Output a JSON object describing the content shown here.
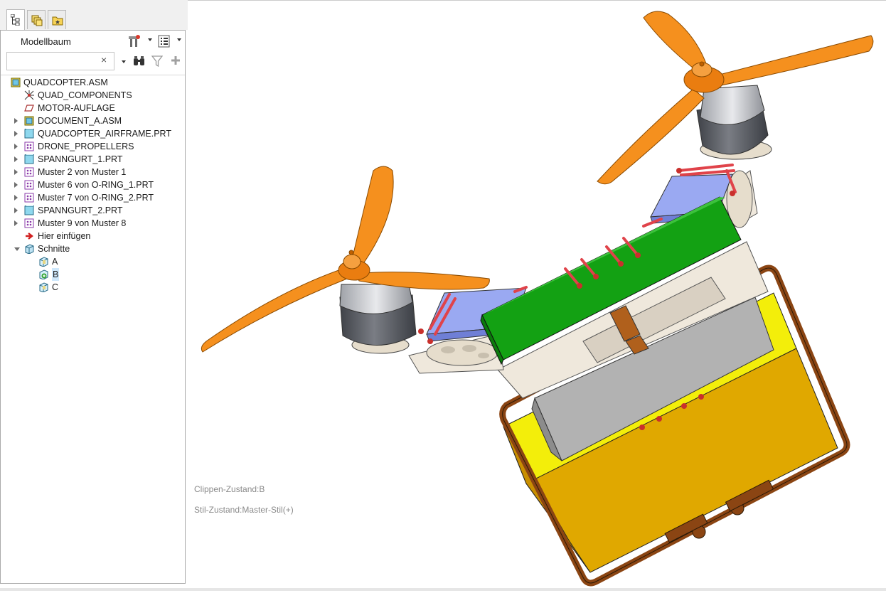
{
  "tabs": [
    {
      "name": "model-tree-tab",
      "icon": "tree-hierarchy-icon",
      "active": true
    },
    {
      "name": "layers-tab",
      "icon": "layers-icon",
      "active": false
    },
    {
      "name": "favorites-tab",
      "icon": "folder-star-icon",
      "active": false
    }
  ],
  "panel": {
    "title": "Modellbaum",
    "search_value": "",
    "clear_glyph": "×",
    "tools": [
      "settings-icon",
      "show-icon",
      "find-icon",
      "filter-icon",
      "add-icon"
    ]
  },
  "tree": [
    {
      "label": "QUADCOPTER.ASM",
      "icon": "assembly-icon",
      "level": 0,
      "arrow": "none"
    },
    {
      "label": "QUAD_COMPONENTS",
      "icon": "csys-icon",
      "level": 1,
      "arrow": "none"
    },
    {
      "label": "MOTOR-AUFLAGE",
      "icon": "plane-icon",
      "level": 1,
      "arrow": "none"
    },
    {
      "label": "DOCUMENT_A.ASM",
      "icon": "assembly-icon",
      "level": 1,
      "arrow": "right"
    },
    {
      "label": "QUADCOPTER_AIRFRAME.PRT",
      "icon": "part-icon",
      "level": 1,
      "arrow": "right"
    },
    {
      "label": "DRONE_PROPELLERS",
      "icon": "pattern-icon",
      "level": 1,
      "arrow": "right"
    },
    {
      "label": "SPANNGURT_1.PRT",
      "icon": "part-icon",
      "level": 1,
      "arrow": "right"
    },
    {
      "label": "Muster 2 von Muster 1",
      "icon": "pattern-icon",
      "level": 1,
      "arrow": "right"
    },
    {
      "label": "Muster 6 von O-RING_1.PRT",
      "icon": "pattern-icon",
      "level": 1,
      "arrow": "right"
    },
    {
      "label": "Muster 7 von O-RING_2.PRT",
      "icon": "pattern-icon",
      "level": 1,
      "arrow": "right"
    },
    {
      "label": "SPANNGURT_2.PRT",
      "icon": "part-icon",
      "level": 1,
      "arrow": "right"
    },
    {
      "label": "Muster 9 von Muster 8",
      "icon": "pattern-icon",
      "level": 1,
      "arrow": "right"
    },
    {
      "label": "Hier einfügen",
      "icon": "insert-arrow-icon",
      "level": 1,
      "arrow": "none"
    },
    {
      "label": "Schnitte",
      "icon": "section-folder-icon",
      "level": 1,
      "arrow": "down"
    },
    {
      "label": "A",
      "icon": "section-icon",
      "level": 2,
      "arrow": "none"
    },
    {
      "label": "B",
      "icon": "section-active-icon",
      "level": 2,
      "arrow": "none",
      "selected": true
    },
    {
      "label": "C",
      "icon": "section-icon",
      "level": 2,
      "arrow": "none"
    }
  ],
  "viewport": {
    "clip_state": "Clippen-Zustand:B",
    "style_state": "Stil-Zustand:Master-Stil(+)"
  },
  "colors": {
    "propeller": "#f5901e",
    "motor": "#5e6168",
    "frame": "#efe8dc",
    "battery": "#13a113",
    "box_face": "#e0a800",
    "box_top": "#f6f000",
    "strap": "#8b4513",
    "pad": "#9aa9f2",
    "oring": "#e0434a"
  }
}
